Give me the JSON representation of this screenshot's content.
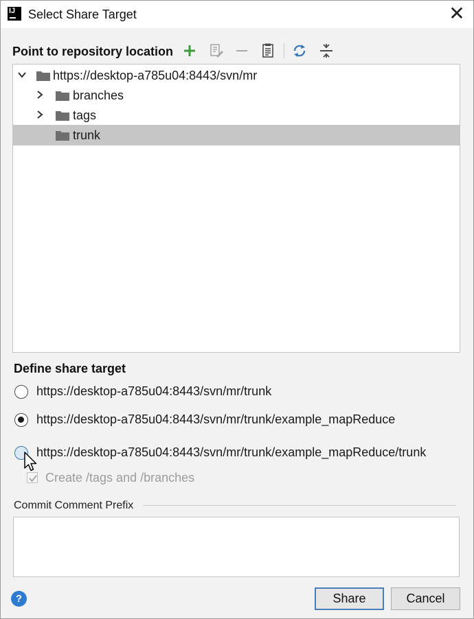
{
  "window": {
    "title": "Select Share Target",
    "app_icon_text": "IJ",
    "close_glyph": "✕"
  },
  "repository": {
    "label": "Point to repository location",
    "toolbar": [
      {
        "icon": "add-icon",
        "color": "#3c9a3c"
      },
      {
        "icon": "edit-icon",
        "color": "#9a9a9a"
      },
      {
        "icon": "remove-icon",
        "color": "#9a9a9a"
      },
      {
        "icon": "browse-icon",
        "color": "#4a4a4a"
      },
      {
        "icon": "refresh-icon",
        "color": "#3a78b8"
      },
      {
        "icon": "collapse-all-icon",
        "color": "#4a4a4a"
      }
    ],
    "tree": [
      {
        "label": "https://desktop-a785u04:8443/svn/mr",
        "level": 0,
        "expanded": true
      },
      {
        "label": "branches",
        "level": 1,
        "expanded": false
      },
      {
        "label": "tags",
        "level": 1,
        "expanded": false
      },
      {
        "label": "trunk",
        "level": 1,
        "leaf": true,
        "selected": true
      }
    ]
  },
  "share_target": {
    "title": "Define share target",
    "options": [
      {
        "label": "https://desktop-a785u04:8443/svn/mr/trunk",
        "checked": false
      },
      {
        "label": "https://desktop-a785u04:8443/svn/mr/trunk/example_mapReduce",
        "checked": true
      },
      {
        "label": "https://desktop-a785u04:8443/svn/mr/trunk/example_mapReduce/trunk",
        "checked": false
      }
    ],
    "create_tags_branches_label": "Create /tags and /branches",
    "create_tags_branches_checked": true
  },
  "commit": {
    "label": "Commit Comment Prefix",
    "value": ""
  },
  "footer": {
    "help_glyph": "?",
    "share_label": "Share",
    "cancel_label": "Cancel"
  },
  "colors": {
    "selection": "#c6c6c6",
    "accent": "#2f7bd1",
    "folder": "#6e6e6e"
  }
}
